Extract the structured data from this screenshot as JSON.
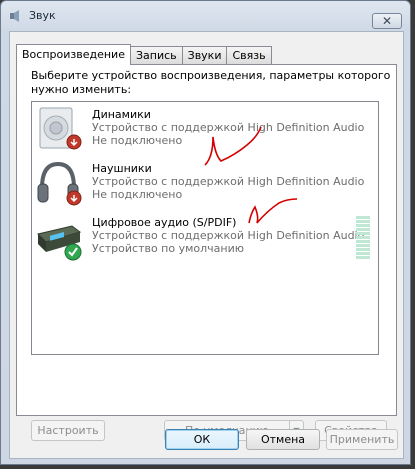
{
  "window": {
    "title": "Звук",
    "close_label": "✕"
  },
  "tabs": [
    {
      "label": "Воспроизведение",
      "active": true
    },
    {
      "label": "Запись",
      "active": false
    },
    {
      "label": "Звуки",
      "active": false
    },
    {
      "label": "Связь",
      "active": false
    }
  ],
  "panel": {
    "prompt": "Выберите устройство воспроизведения, параметры которого нужно изменить:"
  },
  "devices": [
    {
      "name": "Динамики",
      "description": "Устройство с поддержкой High Definition Audio",
      "status": "Не подключено",
      "icon": "speaker-icon",
      "badge": "disconnected-badge"
    },
    {
      "name": "Наушники",
      "description": "Устройство с поддержкой High Definition Audio",
      "status": "Не подключено",
      "icon": "headphones-icon",
      "badge": "disconnected-badge"
    },
    {
      "name": "Цифровое аудио (S/PDIF)",
      "description": "Устройство с поддержкой High Definition Audio",
      "status": "Устройство по умолчанию",
      "icon": "spdif-device-icon",
      "badge": "default-check-badge"
    }
  ],
  "panel_buttons": {
    "configure": "Настроить",
    "set_default": "По умолчанию",
    "properties": "Свойства"
  },
  "dialog_buttons": {
    "ok": "ОК",
    "cancel": "Отмена",
    "apply": "Применить"
  },
  "colors": {
    "accent": "#3c7fb1",
    "disconnected_badge": "#c0392b",
    "default_badge": "#2fa84f",
    "annotation": "#d40000"
  }
}
